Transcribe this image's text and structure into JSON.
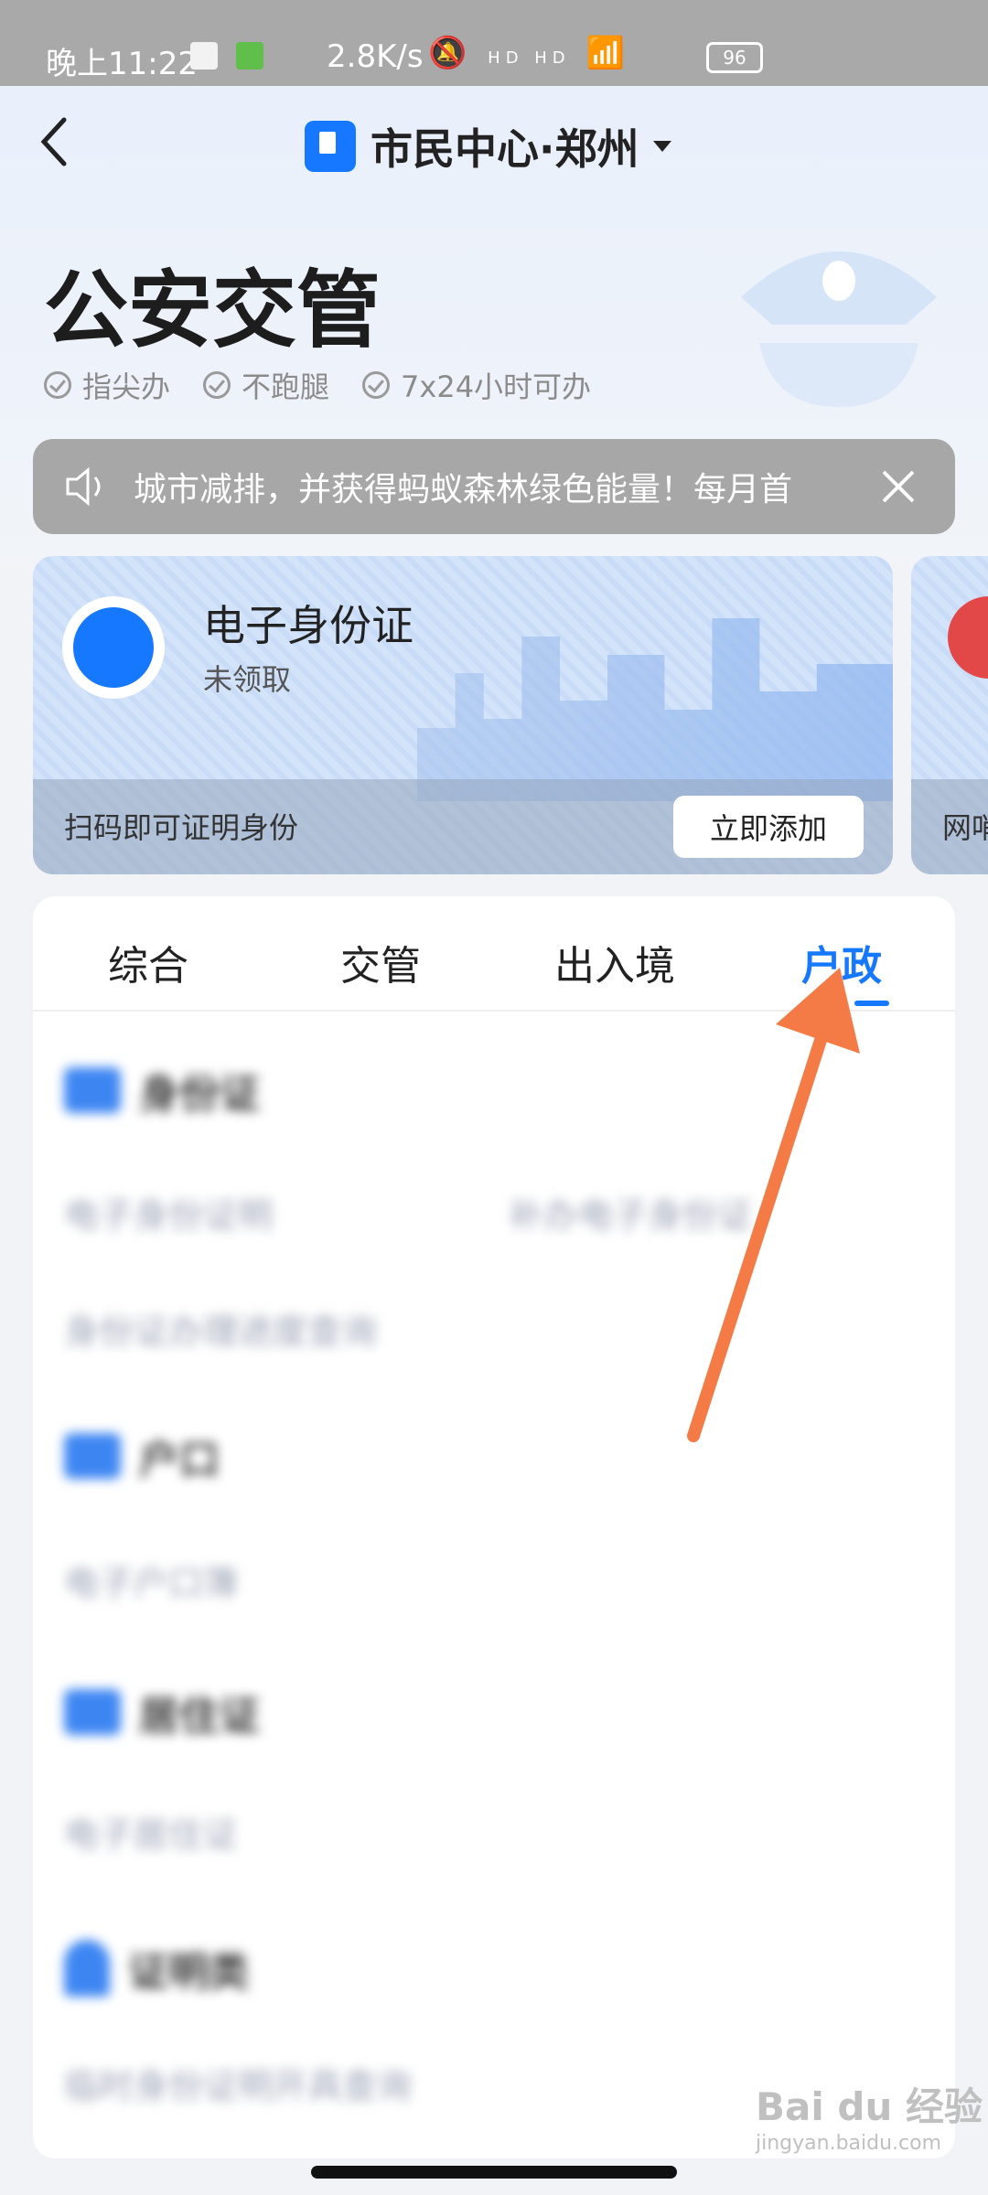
{
  "status_bar": {
    "time": "晚上11:22",
    "net_speed": "2.8K/s",
    "signal_labels": "HD HD",
    "battery": "96"
  },
  "header": {
    "app_title": "市民中心·郑州"
  },
  "page": {
    "title": "公安交管",
    "tags": [
      "指尖办",
      "不跑腿",
      "7x24小时可办"
    ]
  },
  "notice": {
    "text": "城市减排，并获得蚂蚁森林绿色能量！每月首"
  },
  "id_card": {
    "name": "电子身份证",
    "status": "未领取",
    "hint": "扫码即可证明身份",
    "add_button": "立即添加"
  },
  "next_card": {
    "label": "网哨"
  },
  "tabs": [
    "综合",
    "交管",
    "出入境",
    "户政"
  ],
  "active_tab": "户政",
  "sections": [
    {
      "title": "身份证",
      "items": [
        "电子身份证明",
        "补办电子身份证",
        "身份证办理进度查询"
      ]
    },
    {
      "title": "户口",
      "items": [
        "电子户口簿"
      ]
    },
    {
      "title": "居住证",
      "items": [
        "电子居住证"
      ]
    },
    {
      "title": "证明类",
      "items": [
        "临时身份证明开具查询"
      ]
    }
  ],
  "watermark": {
    "brand": "Bai du 经验",
    "url": "jingyan.baidu.com"
  },
  "colors": {
    "accent": "#1677ff",
    "annotation_arrow": "#f47a46"
  }
}
